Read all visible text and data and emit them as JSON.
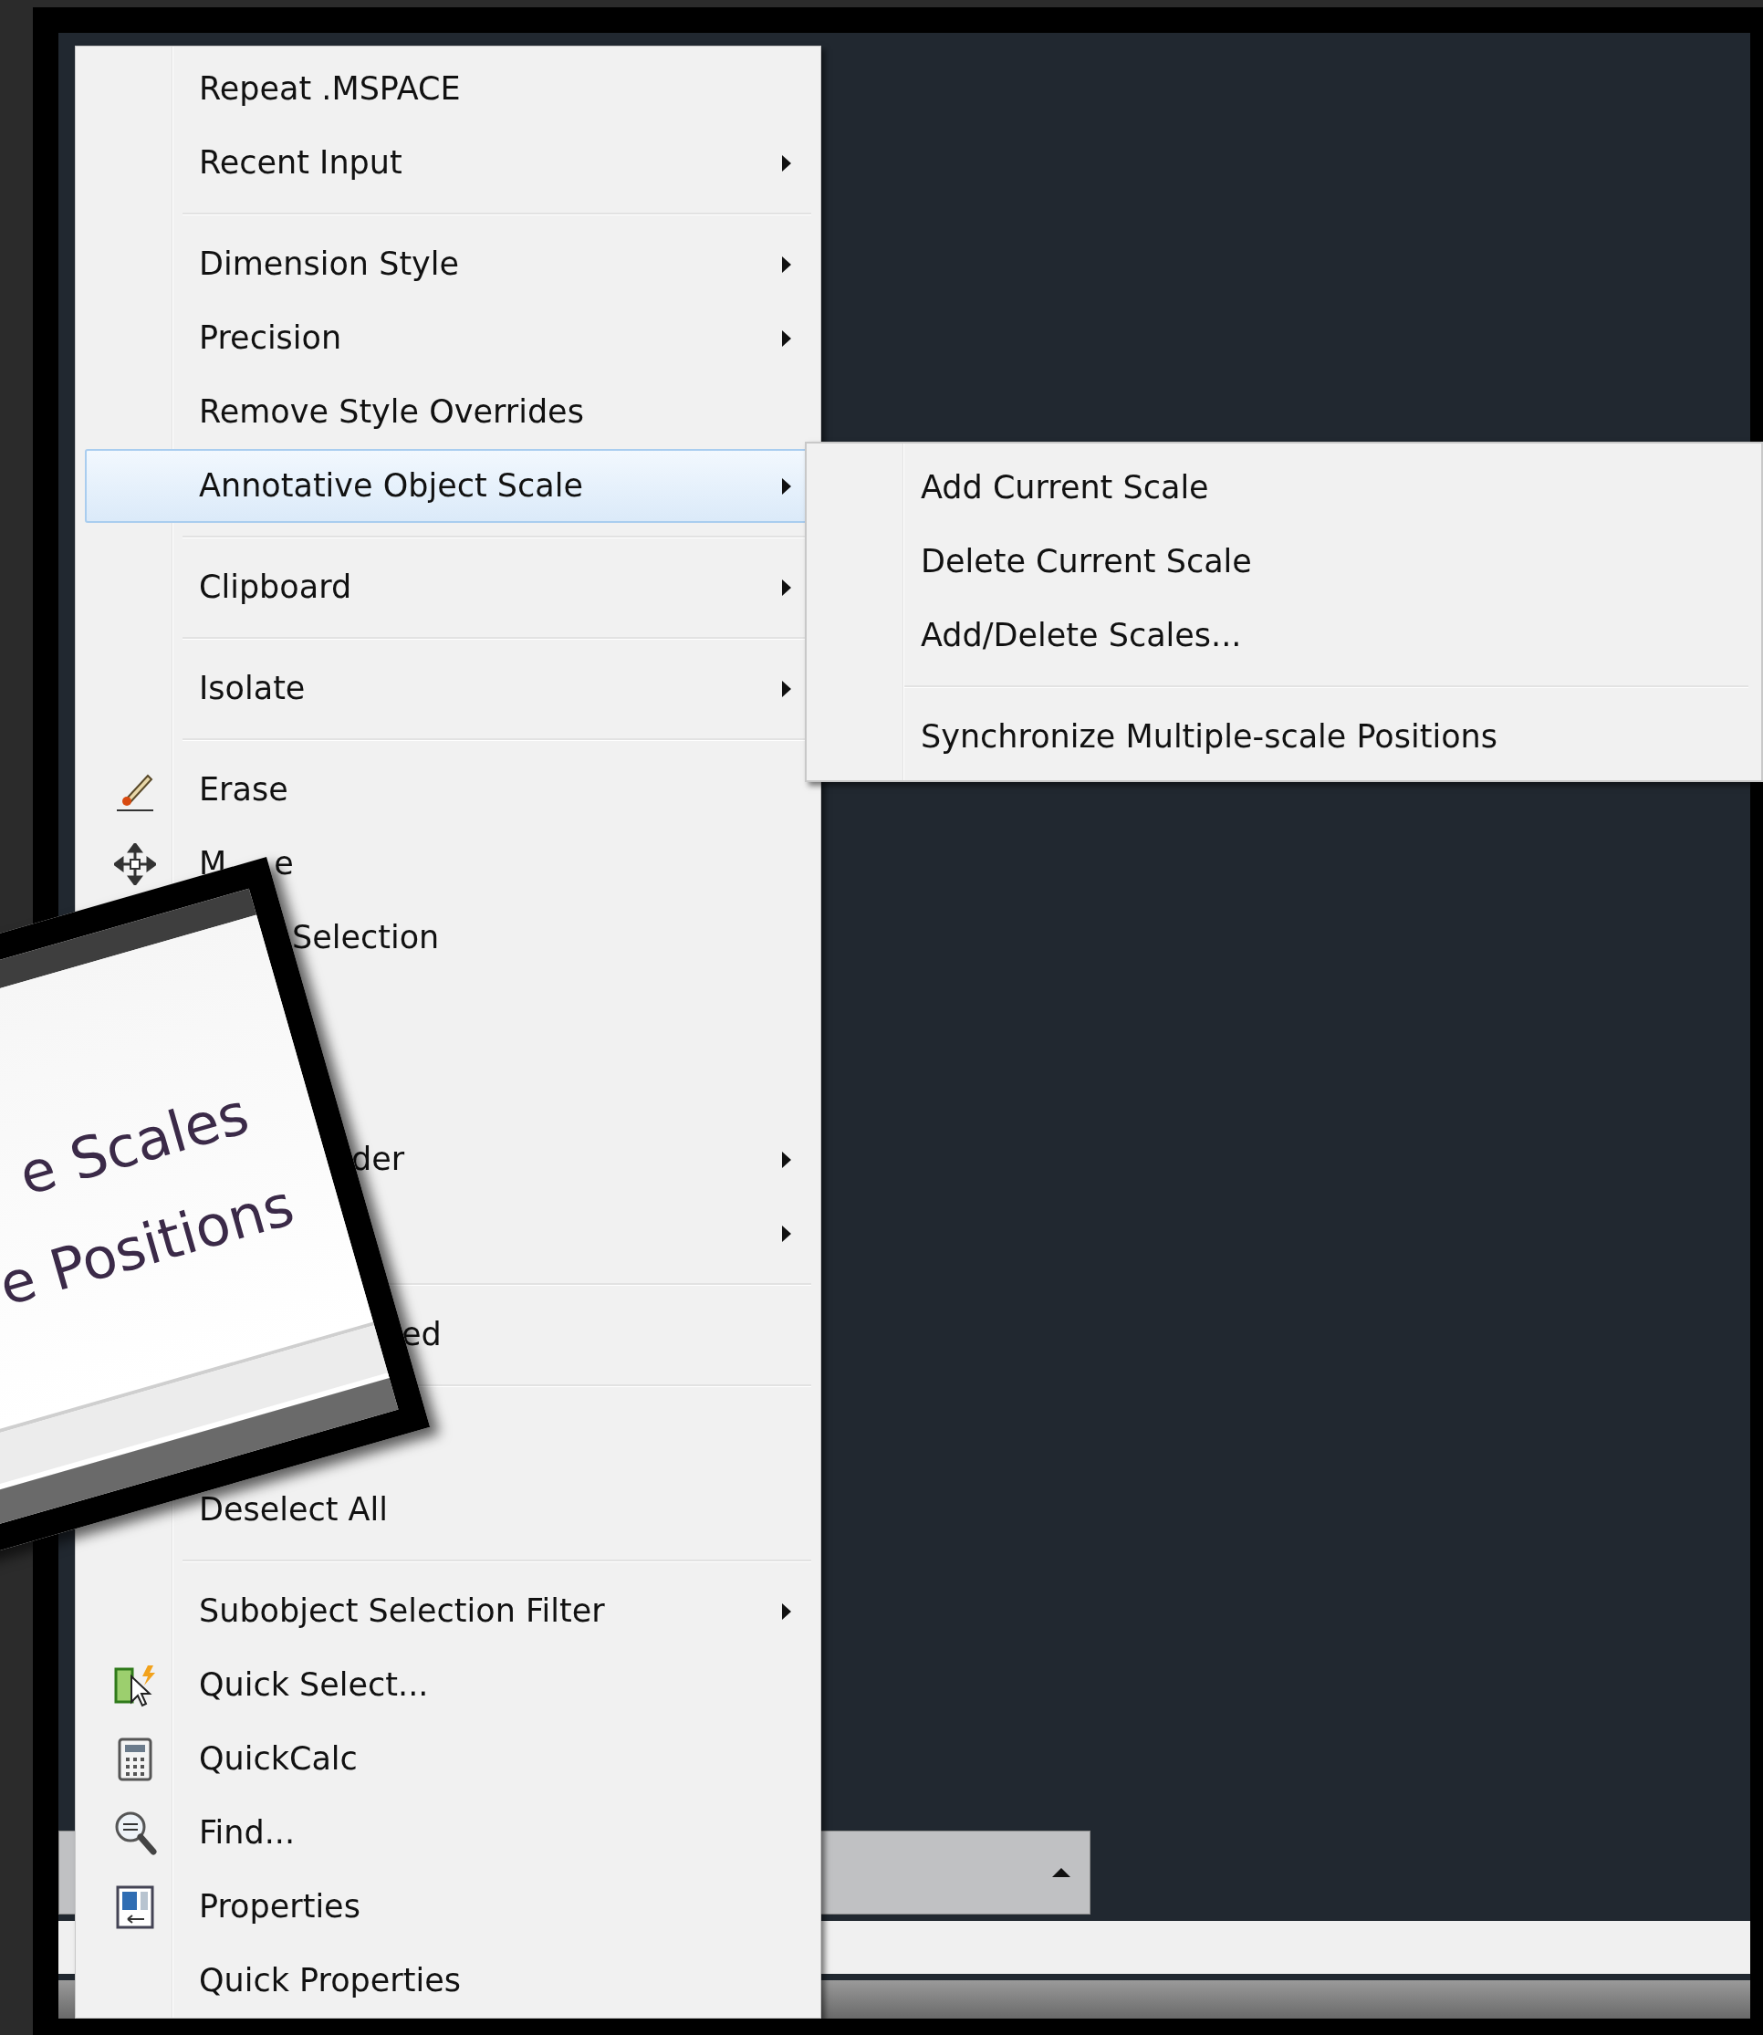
{
  "context_menu": {
    "items": [
      {
        "kind": "item",
        "label": "Repeat .MSPACE",
        "submenu": false,
        "selected": false
      },
      {
        "kind": "item",
        "label": "Recent Input",
        "submenu": true,
        "selected": false
      },
      {
        "kind": "separator"
      },
      {
        "kind": "item",
        "label": "Dimension Style",
        "submenu": true,
        "selected": false
      },
      {
        "kind": "item",
        "label": "Precision",
        "submenu": true,
        "selected": false
      },
      {
        "kind": "item",
        "label": "Remove Style Overrides",
        "submenu": false,
        "selected": false
      },
      {
        "kind": "item",
        "label": "Annotative Object Scale",
        "submenu": true,
        "selected": true
      },
      {
        "kind": "separator"
      },
      {
        "kind": "item",
        "label": "Clipboard",
        "submenu": true,
        "selected": false
      },
      {
        "kind": "separator"
      },
      {
        "kind": "item",
        "label": "Isolate",
        "submenu": true,
        "selected": false
      },
      {
        "kind": "separator"
      },
      {
        "kind": "item",
        "label": "Erase",
        "submenu": false,
        "selected": false
      },
      {
        "kind": "item",
        "parts": [
          "M",
          "e"
        ],
        "submenu": false,
        "selected": false
      },
      {
        "kind": "item",
        "parts": [
          "Selection"
        ],
        "submenu": false,
        "selected": false
      },
      {
        "kind": "item",
        "submenu": false,
        "selected": false
      },
      {
        "kind": "item",
        "submenu": false,
        "selected": false
      },
      {
        "kind": "item",
        "parts": [
          "der"
        ],
        "submenu": true,
        "selected": false
      },
      {
        "kind": "item",
        "submenu": true,
        "selected": false
      },
      {
        "kind": "separator"
      },
      {
        "kind": "item",
        "parts": [
          "ed"
        ],
        "submenu": false,
        "selected": false
      },
      {
        "kind": "separator"
      },
      {
        "kind": "item",
        "submenu": false,
        "selected": false
      },
      {
        "kind": "item",
        "label": "Deselect All",
        "submenu": false,
        "selected": false
      },
      {
        "kind": "separator"
      },
      {
        "kind": "item",
        "label": "Subobject Selection Filter",
        "submenu": true,
        "selected": false
      },
      {
        "kind": "item",
        "label": "Quick Select...",
        "submenu": false,
        "selected": false
      },
      {
        "kind": "item",
        "label": "QuickCalc",
        "submenu": false,
        "selected": false
      },
      {
        "kind": "item",
        "label": "Find...",
        "submenu": false,
        "selected": false
      },
      {
        "kind": "item",
        "label": "Properties",
        "submenu": false,
        "selected": false
      },
      {
        "kind": "item",
        "label": "Quick Properties",
        "submenu": false,
        "selected": false
      }
    ]
  },
  "submenu": {
    "items": [
      {
        "kind": "item",
        "label": "Add Current Scale",
        "selected": false
      },
      {
        "kind": "item",
        "label": "Delete Current Scale",
        "selected": false
      },
      {
        "kind": "item",
        "label": "Add/Delete Scales...",
        "selected": false
      },
      {
        "kind": "separator"
      },
      {
        "kind": "item",
        "label": "Synchronize Multiple-scale Positions",
        "selected": false
      }
    ]
  },
  "magnified_inset": {
    "lines": [
      "e Scales",
      "e Positions"
    ]
  }
}
